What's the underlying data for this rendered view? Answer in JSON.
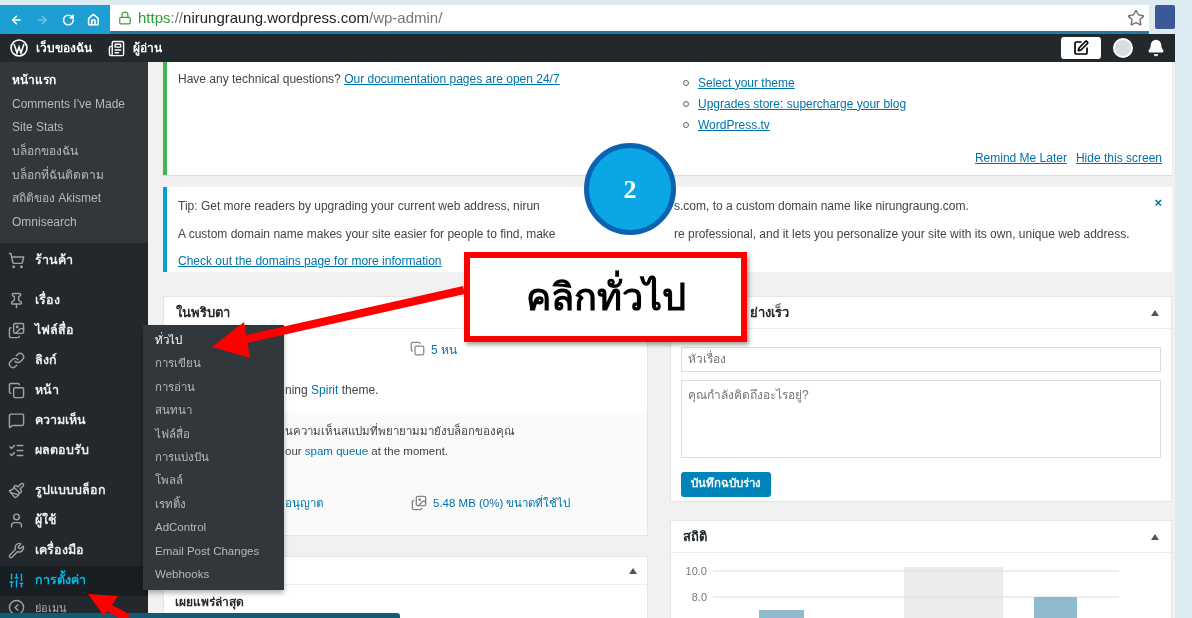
{
  "browser": {
    "nav": [
      {
        "kind": "back",
        "disabled": false
      },
      {
        "kind": "forward",
        "disabled": true
      },
      {
        "kind": "reload",
        "disabled": false
      },
      {
        "kind": "home",
        "disabled": false
      }
    ],
    "url_parts": [
      {
        "kind": "scheme",
        "text": "https"
      },
      {
        "kind": "path",
        "text": "://"
      },
      {
        "kind": "host",
        "text": "nirungraung.wordpress.com"
      },
      {
        "kind": "path",
        "text": "/wp-admin/"
      }
    ]
  },
  "admin_bar": {
    "items": [
      {
        "kind": "wordpress",
        "label": "เว็บของฉัน"
      },
      {
        "kind": "reader",
        "label": "ผู้อ่าน"
      }
    ]
  },
  "sidebar": {
    "home_items": [
      {
        "label": "หน้าแรก",
        "selected": true
      },
      {
        "label": "Comments I've Made",
        "selected": false
      },
      {
        "label": "Site Stats",
        "selected": false
      },
      {
        "label": "บล็อกของฉัน",
        "selected": false
      },
      {
        "label": "บล็อกที่ฉันติดตาม",
        "selected": false
      },
      {
        "label": "สถิติของ Akismet",
        "selected": false
      },
      {
        "label": "Omnisearch",
        "selected": false
      }
    ],
    "menu": [
      {
        "kind": "item",
        "label": "ร้านค้า",
        "selected": false
      },
      {
        "kind": "separator"
      },
      {
        "kind": "item",
        "label": "เรื่อง",
        "selected": false
      },
      {
        "kind": "item",
        "label": "ไฟล์สื่อ",
        "selected": false
      },
      {
        "kind": "item",
        "label": "ลิงก์",
        "selected": false
      },
      {
        "kind": "item",
        "label": "หน้า",
        "selected": false
      },
      {
        "kind": "item",
        "label": "ความเห็น",
        "selected": false
      },
      {
        "kind": "item",
        "label": "ผลตอบรับ",
        "selected": false
      },
      {
        "kind": "separator"
      },
      {
        "kind": "item",
        "label": "รูปแบบบล็อก",
        "selected": false
      },
      {
        "kind": "item",
        "label": "ผู้ใช้",
        "selected": false
      },
      {
        "kind": "item",
        "label": "เครื่องมือ",
        "selected": false
      },
      {
        "kind": "item",
        "label": "การตั้งค่า",
        "selected": true
      },
      {
        "kind": "collapse",
        "label": "ย่อเมนู",
        "selected": false
      }
    ],
    "flyout": [
      {
        "label": "ทั่วไป",
        "selected": true
      },
      {
        "label": "การเขียน",
        "selected": false
      },
      {
        "label": "การอ่าน",
        "selected": false
      },
      {
        "label": "สนทนา",
        "selected": false
      },
      {
        "label": "ไฟล์สื่อ",
        "selected": false
      },
      {
        "label": "การแบ่งปัน",
        "selected": false
      },
      {
        "label": "โพลล์",
        "selected": false
      },
      {
        "label": "เรทติ้ง",
        "selected": false
      },
      {
        "label": "AdControl",
        "selected": false
      },
      {
        "label": "Email Post Changes",
        "selected": false
      },
      {
        "label": "Webhooks",
        "selected": false
      }
    ]
  },
  "welcome": {
    "question": "Have any technical questions?",
    "doc_link": "Our documentation pages are open 24/7",
    "links": [
      "Select your theme",
      "Upgrades store: supercharge your blog",
      "WordPress.tv"
    ],
    "actions": [
      "Remind Me Later",
      "Hide this screen"
    ]
  },
  "notice": {
    "lines": [
      [
        "Tip: Get more readers by upgrading your current web address, nirun",
        "s.com, to a custom domain name like nirungraung.com."
      ],
      [
        "A custom domain name makes your site easier for people to find, make",
        "re professional, and it lets you personalize your site with its own, unique web address."
      ]
    ],
    "link": "Check out the domains page for more information",
    "close": "×"
  },
  "at_a_glance": {
    "title": "ในพริบตา",
    "pages": "5 หน",
    "theme_prefix": "ning",
    "theme_link": "Spirit",
    "theme_suffix": "theme.",
    "akismet_line": "นความเห็นสแปมที่พยายามมายังบล็อกของคุณ",
    "akismet_prefix": "our",
    "akismet_link": "spam queue",
    "akismet_suffix": "at the moment.",
    "allowed_link": "อนุญาต",
    "storage": "5.48 MB (0%) ขนาดที่ใช้ไป"
  },
  "activity": {
    "heading": "เผยแพร่ล่าสุด"
  },
  "quick_draft": {
    "title": "ย่างเร็ว",
    "title_placeholder": "หัวเรื่อง",
    "content_placeholder": "คุณกำลังคิดถึงอะไรอยู่?",
    "save": "บันทึกฉบับร่าง"
  },
  "stats": {
    "title": "สถิติ",
    "axis_labels": [
      "10.0",
      "8.0"
    ]
  },
  "annotation": {
    "step": "2",
    "callout": "คลิกทั่วไป"
  }
}
